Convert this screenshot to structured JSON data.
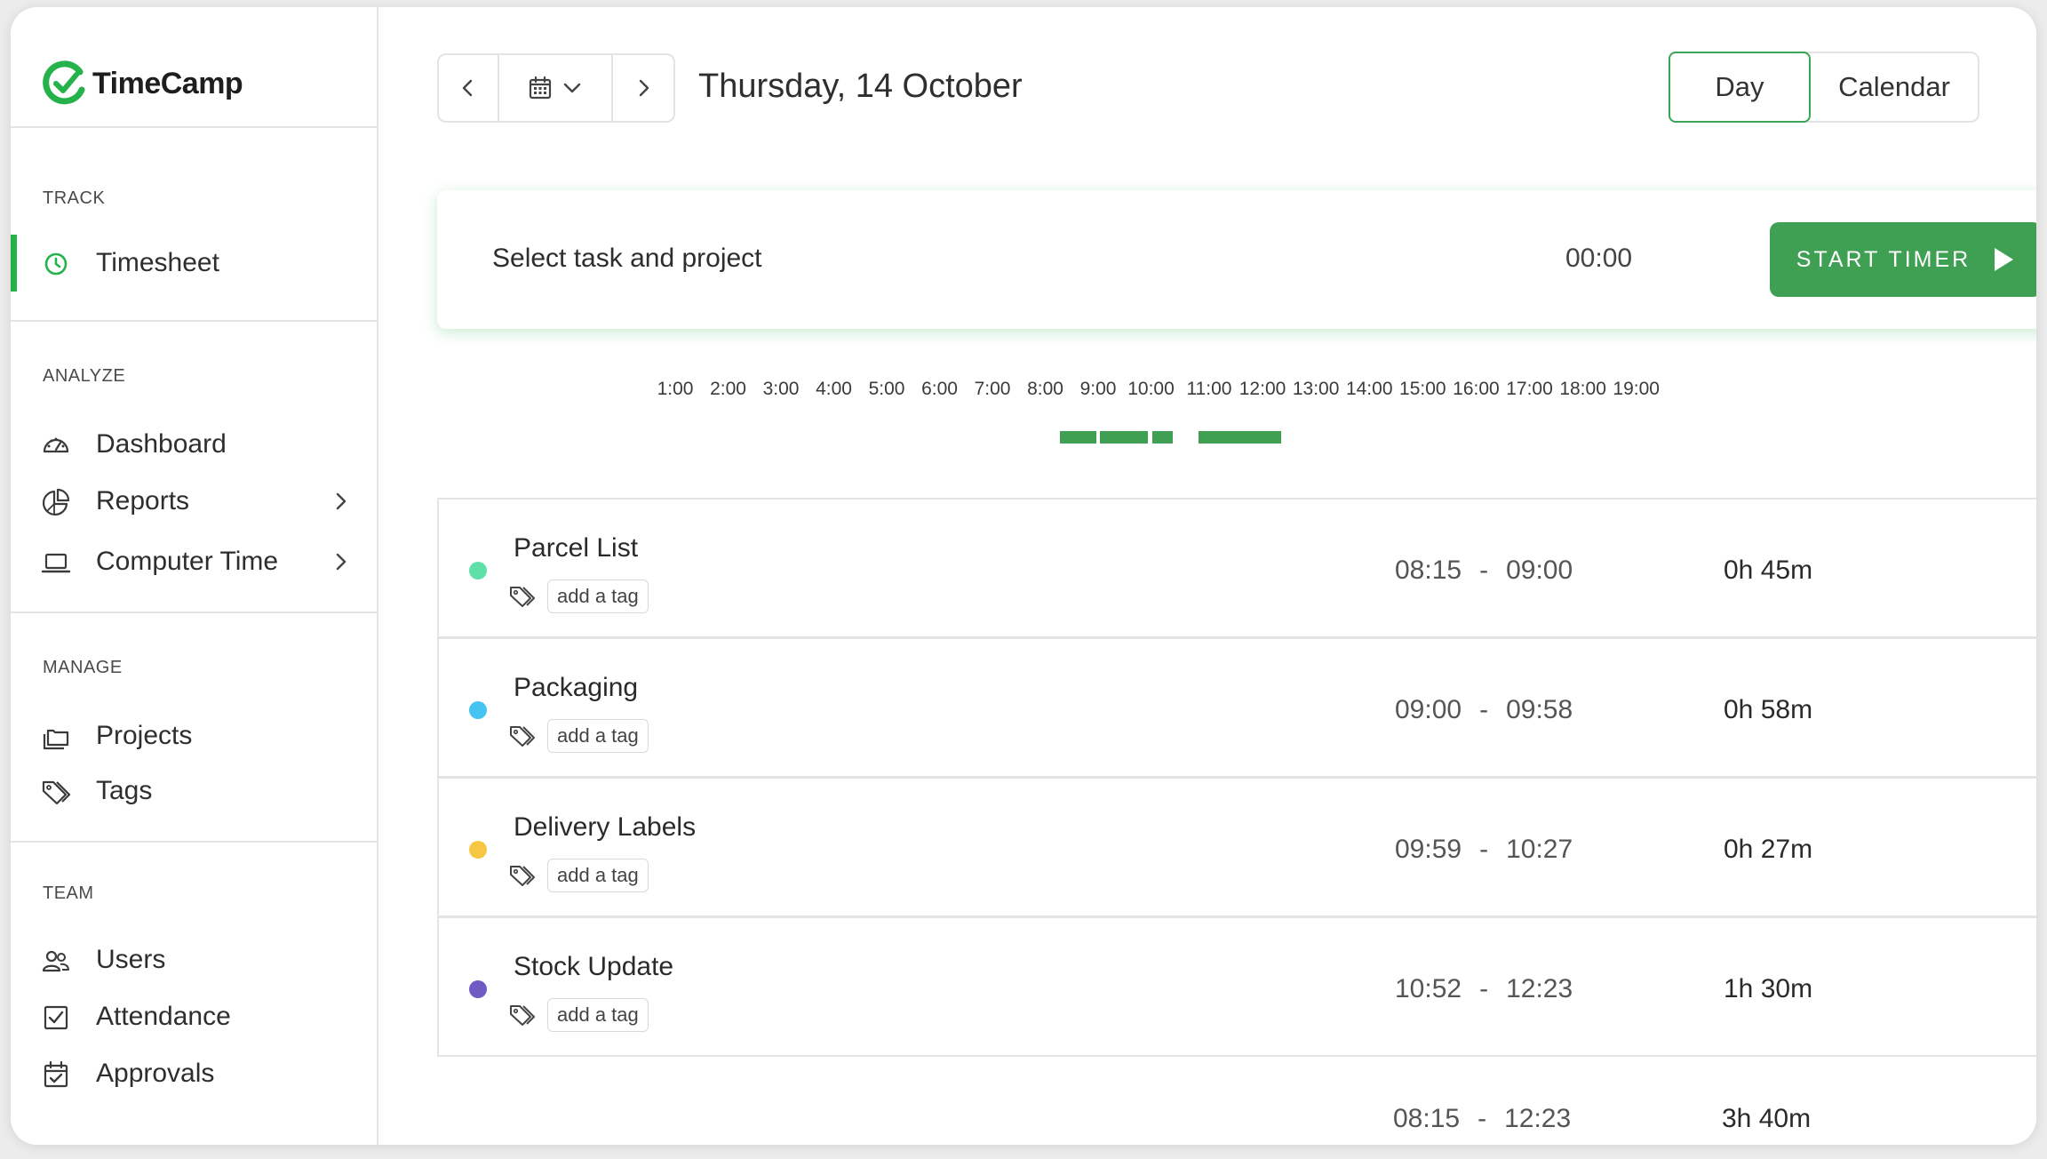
{
  "app": {
    "logo_text": "TimeCamp",
    "brand_color": "#25b24a",
    "accent_color": "#3f9f52"
  },
  "sidebar": {
    "sections": [
      {
        "heading": "TRACK",
        "items": [
          {
            "label": "Timesheet",
            "icon": "clock-icon",
            "active": true
          }
        ]
      },
      {
        "heading": "ANALYZE",
        "items": [
          {
            "label": "Dashboard",
            "icon": "gauge-icon"
          },
          {
            "label": "Reports",
            "icon": "pie-chart-icon",
            "has_submenu": true
          },
          {
            "label": "Computer Time",
            "icon": "laptop-icon",
            "has_submenu": true
          }
        ]
      },
      {
        "heading": "MANAGE",
        "items": [
          {
            "label": "Projects",
            "icon": "folders-icon"
          },
          {
            "label": "Tags",
            "icon": "tags-icon"
          }
        ]
      },
      {
        "heading": "TEAM",
        "items": [
          {
            "label": "Users",
            "icon": "users-icon"
          },
          {
            "label": "Attendance",
            "icon": "checkbox-icon"
          },
          {
            "label": "Approvals",
            "icon": "calendar-check-icon"
          }
        ]
      }
    ]
  },
  "header": {
    "date_title": "Thursday, 14 October",
    "view_day": "Day",
    "view_calendar": "Calendar",
    "active_view": "Day"
  },
  "timer": {
    "task_placeholder": "Select task and project",
    "elapsed": "00:00",
    "start_label": "START TIMER"
  },
  "timeline": {
    "hours": [
      "1:00",
      "2:00",
      "3:00",
      "4:00",
      "5:00",
      "6:00",
      "7:00",
      "8:00",
      "9:00",
      "10:00",
      "11:00",
      "12:00",
      "13:00",
      "14:00",
      "15:00",
      "16:00",
      "17:00",
      "18:00",
      "19:00"
    ]
  },
  "entries": [
    {
      "name": "Parcel List",
      "tag_label": "add a tag",
      "start": "08:15",
      "end": "09:00",
      "duration": "0h 45m",
      "color": "#5ee0a8"
    },
    {
      "name": "Packaging",
      "tag_label": "add a tag",
      "start": "09:00",
      "end": "09:58",
      "duration": "0h 58m",
      "color": "#45c4f2"
    },
    {
      "name": "Delivery Labels",
      "tag_label": "add a tag",
      "start": "09:59",
      "end": "10:27",
      "duration": "0h 27m",
      "color": "#f7c744"
    },
    {
      "name": "Stock Update",
      "tag_label": "add a tag",
      "start": "10:52",
      "end": "12:23",
      "duration": "1h 30m",
      "color": "#6f5bc4"
    }
  ],
  "range_separator": "-",
  "total": {
    "start": "08:15",
    "end": "12:23",
    "duration": "3h 40m"
  }
}
